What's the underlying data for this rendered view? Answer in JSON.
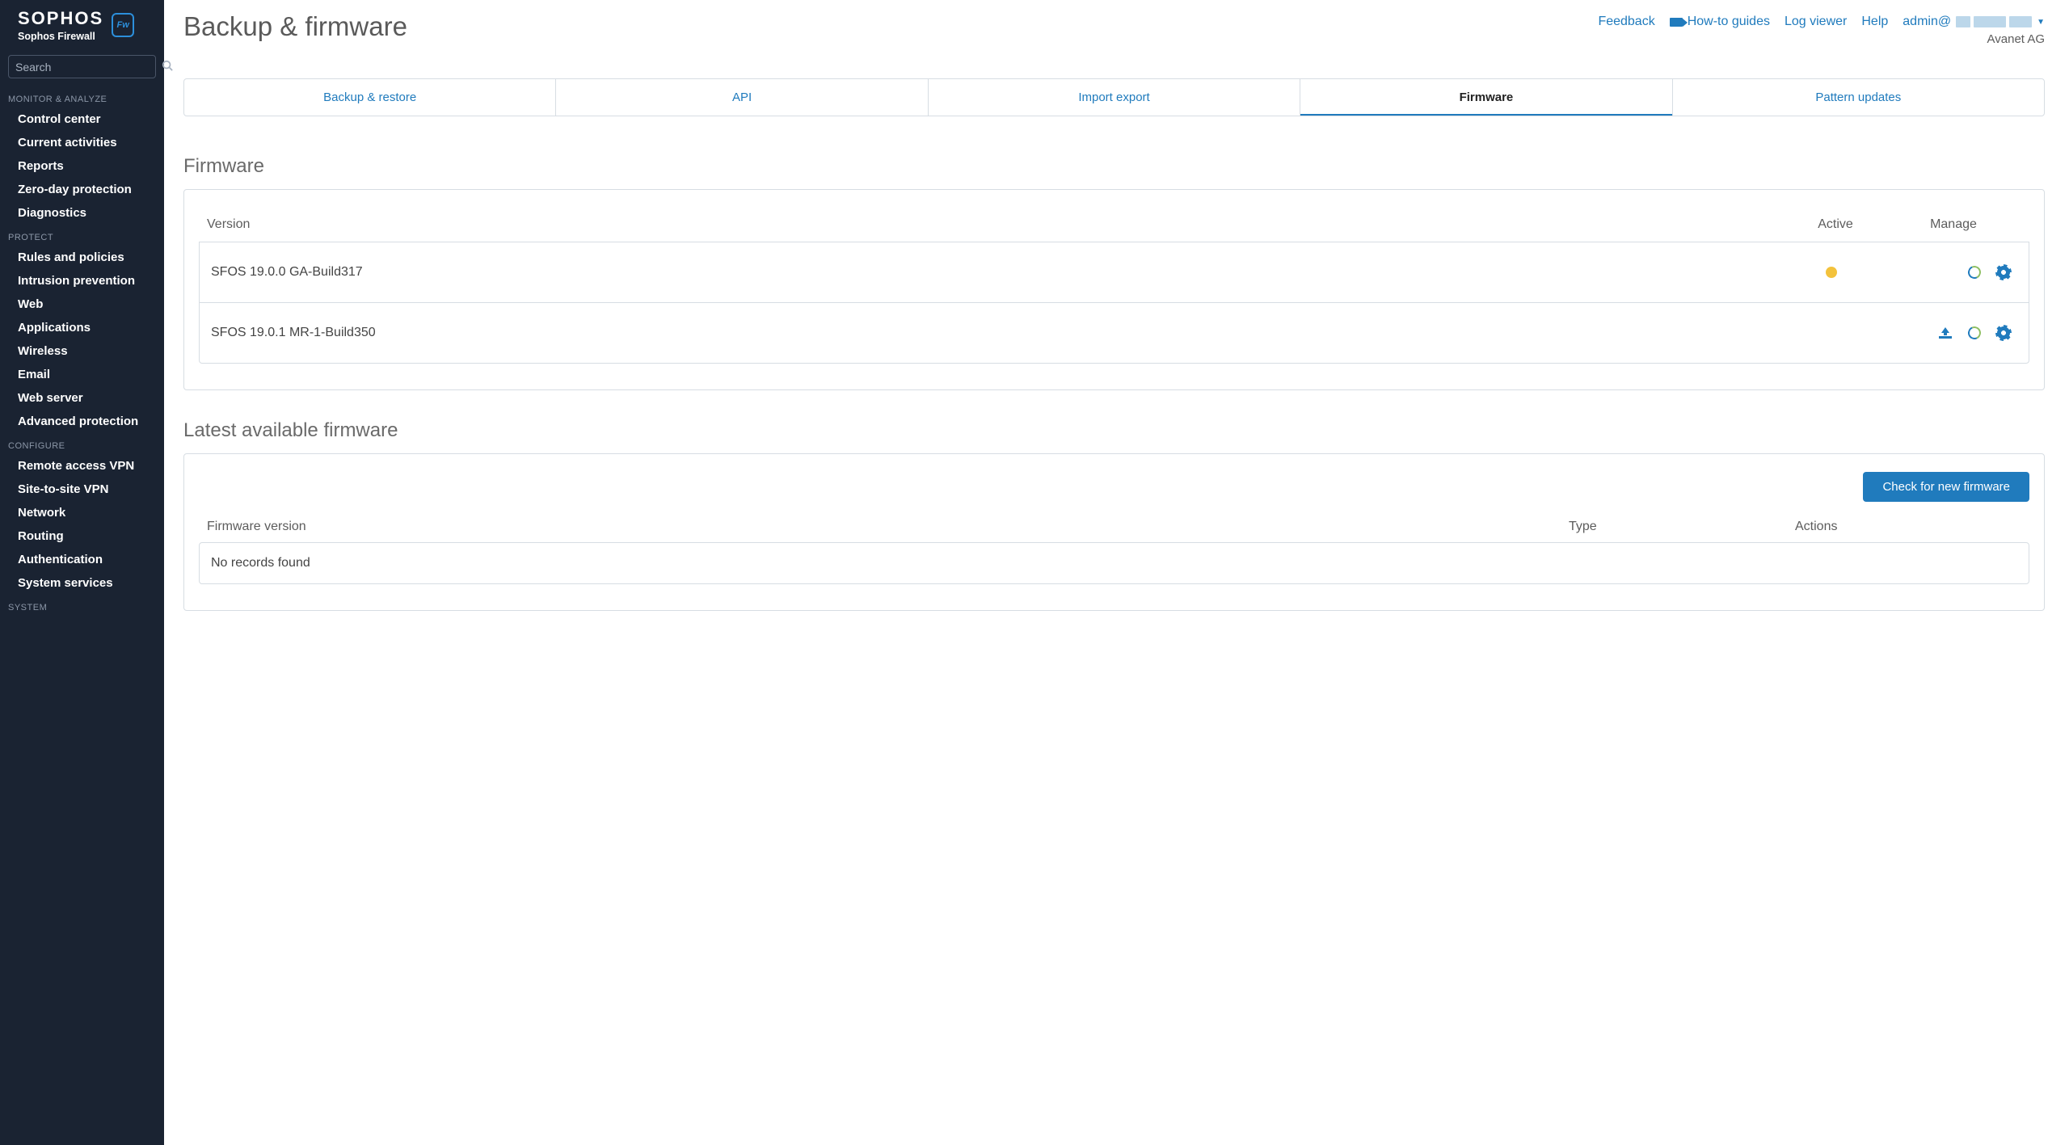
{
  "brand": {
    "title": "SOPHOS",
    "subtitle": "Sophos Firewall",
    "badge": "Fw"
  },
  "search": {
    "placeholder": "Search"
  },
  "nav": {
    "sections": [
      {
        "label": "MONITOR & ANALYZE",
        "items": [
          "Control center",
          "Current activities",
          "Reports",
          "Zero-day protection",
          "Diagnostics"
        ]
      },
      {
        "label": "PROTECT",
        "items": [
          "Rules and policies",
          "Intrusion prevention",
          "Web",
          "Applications",
          "Wireless",
          "Email",
          "Web server",
          "Advanced protection"
        ]
      },
      {
        "label": "CONFIGURE",
        "items": [
          "Remote access VPN",
          "Site-to-site VPN",
          "Network",
          "Routing",
          "Authentication",
          "System services"
        ]
      },
      {
        "label": "SYSTEM",
        "items": []
      }
    ]
  },
  "header": {
    "page_title": "Backup & firmware",
    "links": {
      "feedback": "Feedback",
      "guides": "How-to guides",
      "logviewer": "Log viewer",
      "help": "Help"
    },
    "user_prefix": "admin@",
    "tenant": "Avanet AG"
  },
  "tabs": [
    {
      "label": "Backup & restore",
      "active": false
    },
    {
      "label": "API",
      "active": false
    },
    {
      "label": "Import export",
      "active": false
    },
    {
      "label": "Firmware",
      "active": true
    },
    {
      "label": "Pattern updates",
      "active": false
    }
  ],
  "firmware": {
    "section_title": "Firmware",
    "columns": {
      "version": "Version",
      "active": "Active",
      "manage": "Manage"
    },
    "rows": [
      {
        "version": "SFOS 19.0.0 GA-Build317",
        "active": true,
        "actions": [
          "refresh",
          "gear"
        ]
      },
      {
        "version": "SFOS 19.0.1 MR-1-Build350",
        "active": false,
        "actions": [
          "upload",
          "refresh",
          "gear"
        ]
      }
    ]
  },
  "latest": {
    "section_title": "Latest available firmware",
    "button": "Check for new firmware",
    "columns": {
      "version": "Firmware version",
      "type": "Type",
      "actions": "Actions"
    },
    "empty": "No records found"
  }
}
